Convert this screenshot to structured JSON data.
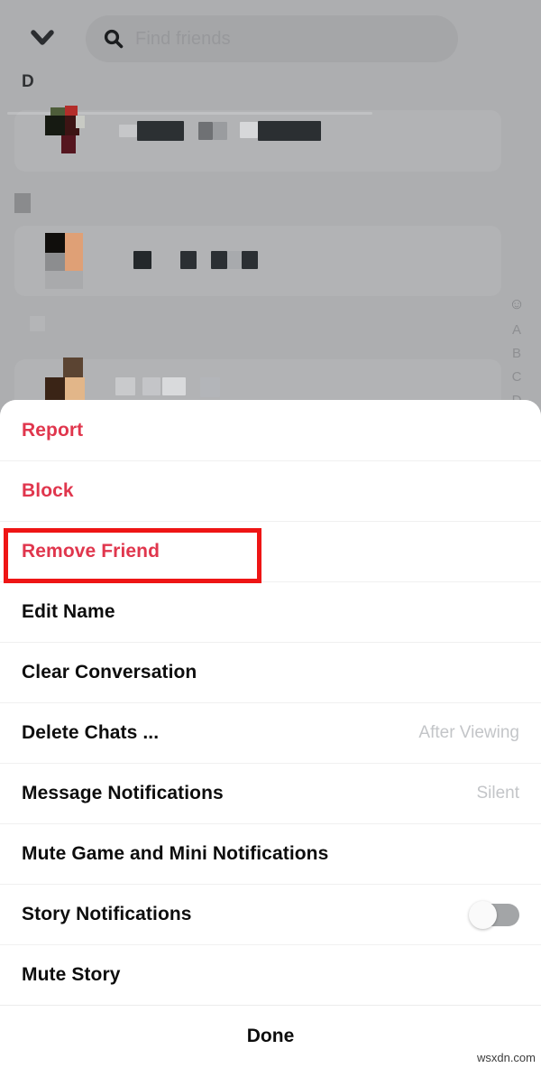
{
  "background_app": {
    "nav": {
      "collapse_icon": "chevron-down-icon",
      "search": {
        "icon": "search-icon",
        "placeholder": "Find friends",
        "value": ""
      }
    },
    "section_header": "D",
    "alpha_index": {
      "emoji": "☺",
      "letters": [
        "A",
        "B",
        "C",
        "D"
      ]
    },
    "friend_rows": [
      {
        "name_redacted": true
      },
      {
        "name_redacted": true
      },
      {
        "name_redacted": true
      }
    ]
  },
  "action_sheet": {
    "items": [
      {
        "label": "Report",
        "style": "danger",
        "value": "",
        "control": "none"
      },
      {
        "label": "Block",
        "style": "danger",
        "value": "",
        "control": "none"
      },
      {
        "label": "Remove Friend",
        "style": "danger",
        "value": "",
        "control": "none",
        "highlighted": true
      },
      {
        "label": "Edit Name",
        "style": "default",
        "value": "",
        "control": "none"
      },
      {
        "label": "Clear Conversation",
        "style": "default",
        "value": "",
        "control": "none"
      },
      {
        "label": "Delete Chats ...",
        "style": "default",
        "value": "After Viewing",
        "control": "none"
      },
      {
        "label": "Message Notifications",
        "style": "default",
        "value": "Silent",
        "control": "none"
      },
      {
        "label": "Mute Game and Mini Notifications",
        "style": "default",
        "value": "",
        "control": "none"
      },
      {
        "label": "Story Notifications",
        "style": "default",
        "value": "",
        "control": "toggle",
        "toggle_on": false
      },
      {
        "label": "Mute Story",
        "style": "default",
        "value": "",
        "control": "none"
      }
    ],
    "done_label": "Done"
  },
  "annotation": {
    "highlight_color": "#ee1515",
    "target_label": "Remove Friend"
  },
  "colors": {
    "danger": "#e0364d",
    "label": "#0d0d0d",
    "value": "#c3c5c8",
    "sheet_bg": "#ffffff",
    "dim_bg": "#adaeb0"
  },
  "watermark": "wsxdn.com"
}
